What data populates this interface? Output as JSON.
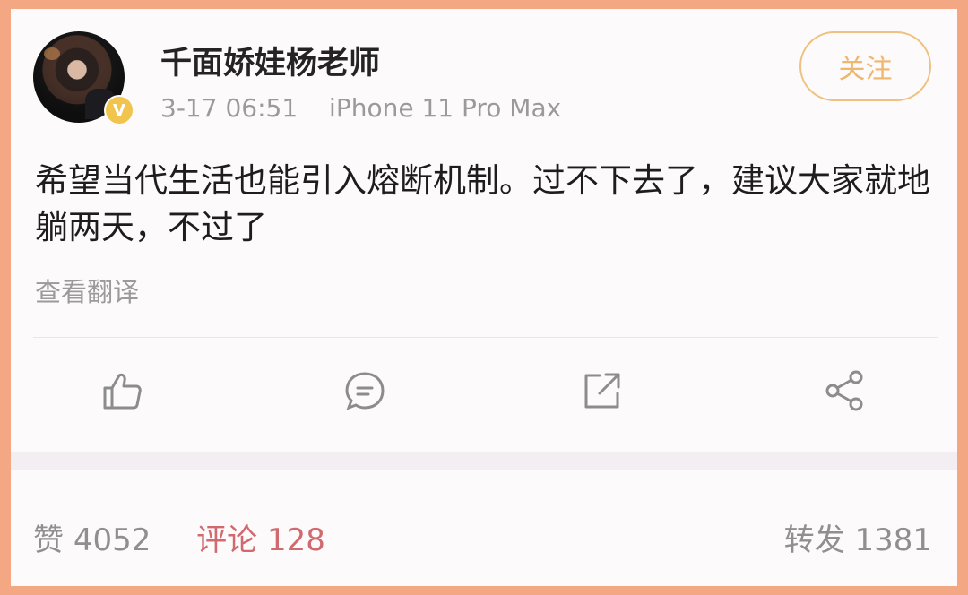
{
  "post": {
    "username": "千面娇娃杨老师",
    "date": "3-17 06:51",
    "device": "iPhone 11 Pro Max",
    "follow_label": "关注",
    "text": "希望当代生活也能引入熔断机制。过不下去了，建议大家就地躺两天，不过了",
    "translate_label": "查看翻译",
    "verified_mark": "V"
  },
  "actions": [
    {
      "icon": "thumbs-up-icon"
    },
    {
      "icon": "comment-icon"
    },
    {
      "icon": "repost-icon"
    },
    {
      "icon": "share-icon"
    }
  ],
  "stats": {
    "likes_label": "赞",
    "likes_count": "4052",
    "comments_label": "评论",
    "comments_count": "128",
    "reposts_label": "转发",
    "reposts_count": "1381"
  },
  "colors": {
    "background_frame": "#f3a883",
    "card": "#fdfafb",
    "follow_accent": "#efb66e",
    "comment_accent": "#d06a6f"
  }
}
